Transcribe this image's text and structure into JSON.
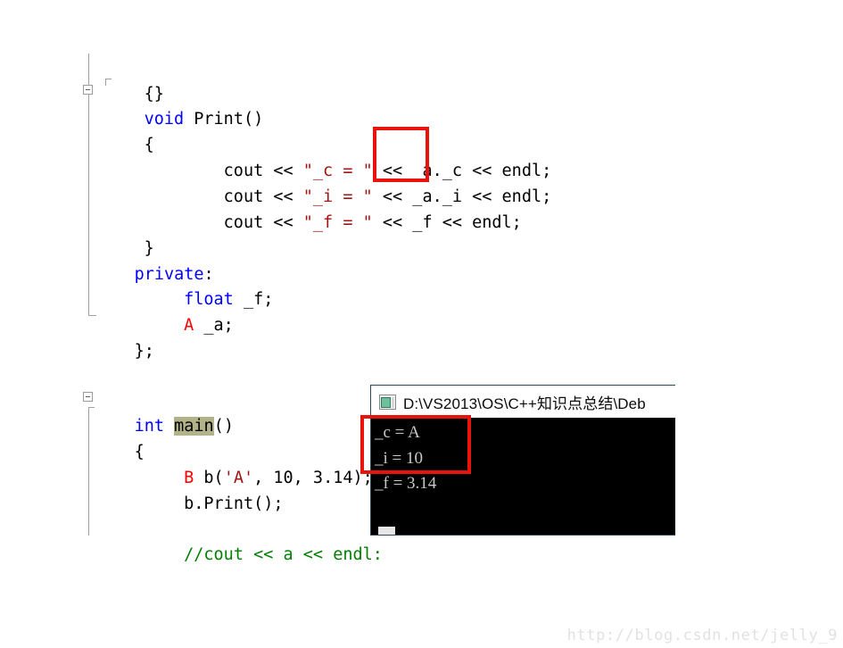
{
  "editor": {
    "language": "cpp",
    "colors": {
      "keyword": "#0000ff",
      "type": "#ff0000",
      "string": "#a31515",
      "comment": "#008000",
      "plain": "#000000",
      "selection_highlight": "#b3b389",
      "annotation_red": "#e8140c"
    },
    "lines": [
      {
        "id": "l1",
        "indent": "    ",
        "segments": [
          {
            "t": "{}",
            "c": "plain"
          }
        ]
      },
      {
        "id": "l2",
        "indent": "    ",
        "segments": [
          {
            "t": "void",
            "c": "kw"
          },
          {
            "t": " Print()",
            "c": "plain"
          }
        ]
      },
      {
        "id": "l3",
        "indent": "    ",
        "segments": [
          {
            "t": "{",
            "c": "plain"
          }
        ]
      },
      {
        "id": "l4",
        "indent": "        ",
        "segments": [
          {
            "t": "cout << ",
            "c": "plain"
          },
          {
            "t": "\"_c = \"",
            "c": "str"
          },
          {
            "t": " << _a._c << endl;",
            "c": "plain"
          }
        ]
      },
      {
        "id": "l5",
        "indent": "        ",
        "segments": [
          {
            "t": "cout << ",
            "c": "plain"
          },
          {
            "t": "\"_i = \"",
            "c": "str"
          },
          {
            "t": " << _a._i << endl;",
            "c": "plain"
          }
        ]
      },
      {
        "id": "l6",
        "indent": "        ",
        "segments": [
          {
            "t": "cout << ",
            "c": "plain"
          },
          {
            "t": "\"_f = \"",
            "c": "str"
          },
          {
            "t": " << _f << endl;",
            "c": "plain"
          }
        ]
      },
      {
        "id": "l7",
        "indent": "    ",
        "segments": [
          {
            "t": "}",
            "c": "plain"
          }
        ]
      },
      {
        "id": "l8",
        "indent": "",
        "segments": [
          {
            "t": "private",
            "c": "kw"
          },
          {
            "t": ":",
            "c": "plain"
          }
        ]
      },
      {
        "id": "l9",
        "indent": "    ",
        "segments": [
          {
            "t": "float",
            "c": "kw"
          },
          {
            "t": " _f;",
            "c": "plain"
          }
        ]
      },
      {
        "id": "l10",
        "indent": "    ",
        "segments": [
          {
            "t": "A",
            "c": "type"
          },
          {
            "t": " _a;",
            "c": "plain"
          }
        ]
      },
      {
        "id": "l11",
        "indent": "",
        "segments": [
          {
            "t": "};",
            "c": "plain"
          }
        ]
      },
      {
        "id": "l12",
        "indent": "",
        "segments": [
          {
            "t": "int",
            "c": "kw"
          },
          {
            "t": " ",
            "c": "plain"
          },
          {
            "t": "main",
            "c": "plain hl"
          },
          {
            "t": "()",
            "c": "plain"
          }
        ]
      },
      {
        "id": "l13",
        "indent": "",
        "segments": [
          {
            "t": "{",
            "c": "plain"
          }
        ]
      },
      {
        "id": "l14",
        "indent": "    ",
        "segments": [
          {
            "t": "B",
            "c": "type"
          },
          {
            "t": " b(",
            "c": "plain"
          },
          {
            "t": "'A'",
            "c": "str"
          },
          {
            "t": ", 10, 3.14);",
            "c": "plain"
          }
        ]
      },
      {
        "id": "l15",
        "indent": "    ",
        "segments": [
          {
            "t": "b.Print();",
            "c": "plain"
          }
        ]
      },
      {
        "id": "l16",
        "indent": "    ",
        "segments": [
          {
            "t": "//cout << a << endl:",
            "c": "cmt"
          }
        ]
      }
    ],
    "fold_markers": [
      {
        "id": "fold-print",
        "state": "expanded",
        "glyph": "minus"
      },
      {
        "id": "fold-main",
        "state": "expanded",
        "glyph": "minus"
      }
    ],
    "annotations": [
      {
        "id": "ann-member-access",
        "label": "red-highlight-box-member-access"
      },
      {
        "id": "ann-console-output",
        "label": "red-highlight-box-console-output"
      }
    ]
  },
  "console": {
    "title": "D:\\VS2013\\OS\\C++知识点总结\\Deb",
    "icon": "console-window-icon",
    "output_lines": [
      "_c = A",
      "_i = 10",
      "_f = 3.14"
    ],
    "cursor": "block-cursor"
  },
  "watermark": {
    "text": "http://blog.csdn.net/jelly_9"
  }
}
